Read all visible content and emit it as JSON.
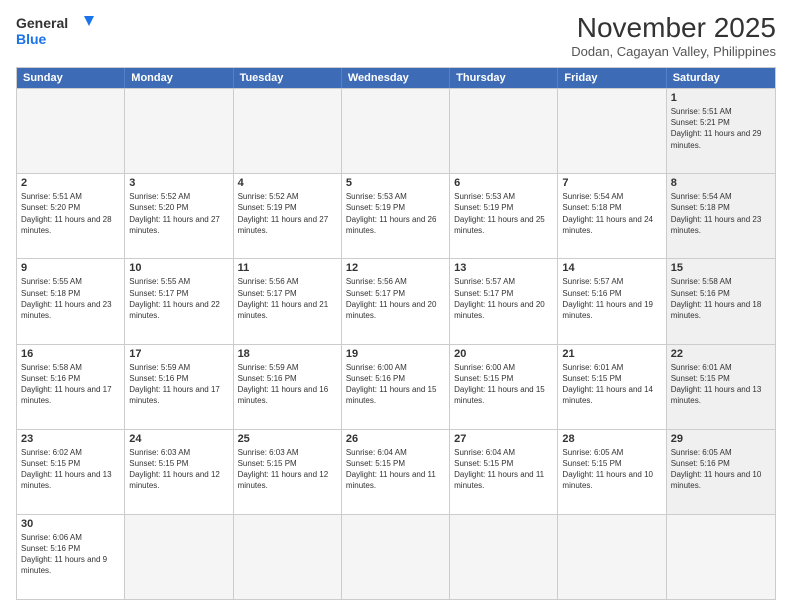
{
  "header": {
    "logo_line1": "General",
    "logo_line2": "Blue",
    "month_title": "November 2025",
    "location": "Dodan, Cagayan Valley, Philippines"
  },
  "weekdays": [
    "Sunday",
    "Monday",
    "Tuesday",
    "Wednesday",
    "Thursday",
    "Friday",
    "Saturday"
  ],
  "rows": [
    [
      {
        "day": "",
        "empty": true
      },
      {
        "day": "",
        "empty": true
      },
      {
        "day": "",
        "empty": true
      },
      {
        "day": "",
        "empty": true
      },
      {
        "day": "",
        "empty": true
      },
      {
        "day": "",
        "empty": true
      },
      {
        "day": "1",
        "sunrise": "Sunrise: 5:51 AM",
        "sunset": "Sunset: 5:21 PM",
        "daylight": "Daylight: 11 hours and 29 minutes.",
        "shaded": true
      }
    ],
    [
      {
        "day": "2",
        "sunrise": "Sunrise: 5:51 AM",
        "sunset": "Sunset: 5:20 PM",
        "daylight": "Daylight: 11 hours and 28 minutes.",
        "shaded": false
      },
      {
        "day": "3",
        "sunrise": "Sunrise: 5:52 AM",
        "sunset": "Sunset: 5:20 PM",
        "daylight": "Daylight: 11 hours and 27 minutes.",
        "shaded": false
      },
      {
        "day": "4",
        "sunrise": "Sunrise: 5:52 AM",
        "sunset": "Sunset: 5:19 PM",
        "daylight": "Daylight: 11 hours and 27 minutes.",
        "shaded": false
      },
      {
        "day": "5",
        "sunrise": "Sunrise: 5:53 AM",
        "sunset": "Sunset: 5:19 PM",
        "daylight": "Daylight: 11 hours and 26 minutes.",
        "shaded": false
      },
      {
        "day": "6",
        "sunrise": "Sunrise: 5:53 AM",
        "sunset": "Sunset: 5:19 PM",
        "daylight": "Daylight: 11 hours and 25 minutes.",
        "shaded": false
      },
      {
        "day": "7",
        "sunrise": "Sunrise: 5:54 AM",
        "sunset": "Sunset: 5:18 PM",
        "daylight": "Daylight: 11 hours and 24 minutes.",
        "shaded": false
      },
      {
        "day": "8",
        "sunrise": "Sunrise: 5:54 AM",
        "sunset": "Sunset: 5:18 PM",
        "daylight": "Daylight: 11 hours and 23 minutes.",
        "shaded": true
      }
    ],
    [
      {
        "day": "9",
        "sunrise": "Sunrise: 5:55 AM",
        "sunset": "Sunset: 5:18 PM",
        "daylight": "Daylight: 11 hours and 23 minutes.",
        "shaded": false
      },
      {
        "day": "10",
        "sunrise": "Sunrise: 5:55 AM",
        "sunset": "Sunset: 5:17 PM",
        "daylight": "Daylight: 11 hours and 22 minutes.",
        "shaded": false
      },
      {
        "day": "11",
        "sunrise": "Sunrise: 5:56 AM",
        "sunset": "Sunset: 5:17 PM",
        "daylight": "Daylight: 11 hours and 21 minutes.",
        "shaded": false
      },
      {
        "day": "12",
        "sunrise": "Sunrise: 5:56 AM",
        "sunset": "Sunset: 5:17 PM",
        "daylight": "Daylight: 11 hours and 20 minutes.",
        "shaded": false
      },
      {
        "day": "13",
        "sunrise": "Sunrise: 5:57 AM",
        "sunset": "Sunset: 5:17 PM",
        "daylight": "Daylight: 11 hours and 20 minutes.",
        "shaded": false
      },
      {
        "day": "14",
        "sunrise": "Sunrise: 5:57 AM",
        "sunset": "Sunset: 5:16 PM",
        "daylight": "Daylight: 11 hours and 19 minutes.",
        "shaded": false
      },
      {
        "day": "15",
        "sunrise": "Sunrise: 5:58 AM",
        "sunset": "Sunset: 5:16 PM",
        "daylight": "Daylight: 11 hours and 18 minutes.",
        "shaded": true
      }
    ],
    [
      {
        "day": "16",
        "sunrise": "Sunrise: 5:58 AM",
        "sunset": "Sunset: 5:16 PM",
        "daylight": "Daylight: 11 hours and 17 minutes.",
        "shaded": false
      },
      {
        "day": "17",
        "sunrise": "Sunrise: 5:59 AM",
        "sunset": "Sunset: 5:16 PM",
        "daylight": "Daylight: 11 hours and 17 minutes.",
        "shaded": false
      },
      {
        "day": "18",
        "sunrise": "Sunrise: 5:59 AM",
        "sunset": "Sunset: 5:16 PM",
        "daylight": "Daylight: 11 hours and 16 minutes.",
        "shaded": false
      },
      {
        "day": "19",
        "sunrise": "Sunrise: 6:00 AM",
        "sunset": "Sunset: 5:16 PM",
        "daylight": "Daylight: 11 hours and 15 minutes.",
        "shaded": false
      },
      {
        "day": "20",
        "sunrise": "Sunrise: 6:00 AM",
        "sunset": "Sunset: 5:15 PM",
        "daylight": "Daylight: 11 hours and 15 minutes.",
        "shaded": false
      },
      {
        "day": "21",
        "sunrise": "Sunrise: 6:01 AM",
        "sunset": "Sunset: 5:15 PM",
        "daylight": "Daylight: 11 hours and 14 minutes.",
        "shaded": false
      },
      {
        "day": "22",
        "sunrise": "Sunrise: 6:01 AM",
        "sunset": "Sunset: 5:15 PM",
        "daylight": "Daylight: 11 hours and 13 minutes.",
        "shaded": true
      }
    ],
    [
      {
        "day": "23",
        "sunrise": "Sunrise: 6:02 AM",
        "sunset": "Sunset: 5:15 PM",
        "daylight": "Daylight: 11 hours and 13 minutes.",
        "shaded": false
      },
      {
        "day": "24",
        "sunrise": "Sunrise: 6:03 AM",
        "sunset": "Sunset: 5:15 PM",
        "daylight": "Daylight: 11 hours and 12 minutes.",
        "shaded": false
      },
      {
        "day": "25",
        "sunrise": "Sunrise: 6:03 AM",
        "sunset": "Sunset: 5:15 PM",
        "daylight": "Daylight: 11 hours and 12 minutes.",
        "shaded": false
      },
      {
        "day": "26",
        "sunrise": "Sunrise: 6:04 AM",
        "sunset": "Sunset: 5:15 PM",
        "daylight": "Daylight: 11 hours and 11 minutes.",
        "shaded": false
      },
      {
        "day": "27",
        "sunrise": "Sunrise: 6:04 AM",
        "sunset": "Sunset: 5:15 PM",
        "daylight": "Daylight: 11 hours and 11 minutes.",
        "shaded": false
      },
      {
        "day": "28",
        "sunrise": "Sunrise: 6:05 AM",
        "sunset": "Sunset: 5:15 PM",
        "daylight": "Daylight: 11 hours and 10 minutes.",
        "shaded": false
      },
      {
        "day": "29",
        "sunrise": "Sunrise: 6:05 AM",
        "sunset": "Sunset: 5:16 PM",
        "daylight": "Daylight: 11 hours and 10 minutes.",
        "shaded": true
      }
    ],
    [
      {
        "day": "30",
        "sunrise": "Sunrise: 6:06 AM",
        "sunset": "Sunset: 5:16 PM",
        "daylight": "Daylight: 11 hours and 9 minutes.",
        "shaded": false
      },
      {
        "day": "",
        "empty": true
      },
      {
        "day": "",
        "empty": true
      },
      {
        "day": "",
        "empty": true
      },
      {
        "day": "",
        "empty": true
      },
      {
        "day": "",
        "empty": true
      },
      {
        "day": "",
        "empty": true
      }
    ]
  ]
}
